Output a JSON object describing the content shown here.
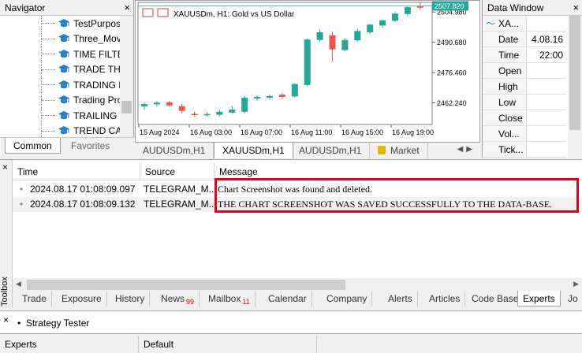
{
  "navigator": {
    "title": "Navigator",
    "items": [
      {
        "label": "TestPurpos"
      },
      {
        "label": "Three_Mov"
      },
      {
        "label": "TIME FILTE"
      },
      {
        "label": "TRADE THE"
      },
      {
        "label": "TRADING D"
      },
      {
        "label": "Trading Pro"
      },
      {
        "label": "TRAILING S"
      },
      {
        "label": "TREND CA"
      }
    ],
    "tabs": {
      "common": "Common",
      "favorites": "Favorites"
    }
  },
  "chart": {
    "title": "XAUUSDm, H1:  Gold vs US Dollar",
    "current_price": "2507.820",
    "colors": {
      "bull": "#26a69a",
      "bear": "#ef5350",
      "price_line": "#26a69a",
      "price_badge": "#26a69a"
    },
    "chart_data": {
      "type": "candlestick",
      "price_labels": [
        "2504.980",
        "2490.680",
        "2476.460",
        "2462.240"
      ],
      "price_values": [
        2504.98,
        2490.68,
        2476.46,
        2462.24
      ],
      "x_tick_labels": [
        "15 Aug 2024",
        "16 Aug 03:00",
        "16 Aug 07:00",
        "16 Aug 11:00",
        "16 Aug 15:00",
        "16 Aug 19:00"
      ],
      "ylim": [
        2452,
        2508
      ],
      "candles": [
        {
          "o": 2460.5,
          "h": 2462.2,
          "l": 2458.8,
          "c": 2461.6
        },
        {
          "o": 2461.5,
          "h": 2463.0,
          "l": 2460.4,
          "c": 2462.3
        },
        {
          "o": 2462.4,
          "h": 2463.2,
          "l": 2460.2,
          "c": 2461.0
        },
        {
          "o": 2460.6,
          "h": 2461.8,
          "l": 2457.2,
          "c": 2458.4
        },
        {
          "o": 2457.0,
          "h": 2458.0,
          "l": 2455.6,
          "c": 2456.8
        },
        {
          "o": 2456.4,
          "h": 2457.8,
          "l": 2455.6,
          "c": 2456.9
        },
        {
          "o": 2456.6,
          "h": 2458.8,
          "l": 2456.0,
          "c": 2458.0
        },
        {
          "o": 2457.6,
          "h": 2460.6,
          "l": 2457.0,
          "c": 2459.0
        },
        {
          "o": 2458.0,
          "h": 2465.4,
          "l": 2457.2,
          "c": 2464.6
        },
        {
          "o": 2464.2,
          "h": 2465.6,
          "l": 2463.2,
          "c": 2465.0
        },
        {
          "o": 2464.6,
          "h": 2466.2,
          "l": 2463.8,
          "c": 2465.4
        },
        {
          "o": 2466.0,
          "h": 2466.8,
          "l": 2464.2,
          "c": 2465.0
        },
        {
          "o": 2465.2,
          "h": 2471.4,
          "l": 2464.6,
          "c": 2471.0
        },
        {
          "o": 2470.6,
          "h": 2492.6,
          "l": 2470.0,
          "c": 2492.0
        },
        {
          "o": 2491.8,
          "h": 2496.8,
          "l": 2491.0,
          "c": 2495.4
        },
        {
          "o": 2494.0,
          "h": 2495.6,
          "l": 2481.8,
          "c": 2487.4
        },
        {
          "o": 2487.0,
          "h": 2492.6,
          "l": 2486.6,
          "c": 2491.8
        },
        {
          "o": 2491.6,
          "h": 2497.2,
          "l": 2491.0,
          "c": 2496.0
        },
        {
          "o": 2495.4,
          "h": 2499.4,
          "l": 2494.6,
          "c": 2499.0
        },
        {
          "o": 2498.6,
          "h": 2501.4,
          "l": 2497.6,
          "c": 2501.0
        },
        {
          "o": 2500.8,
          "h": 2505.0,
          "l": 2500.2,
          "c": 2504.2
        },
        {
          "o": 2504.0,
          "h": 2507.6,
          "l": 2502.8,
          "c": 2507.2
        },
        {
          "o": 2507.6,
          "h": 2509.8,
          "l": 2506.0,
          "c": 2507.0
        }
      ]
    },
    "tabs": [
      {
        "label": "AUDUSDm,H1"
      },
      {
        "label": "XAUUSDm,H1"
      },
      {
        "label": "AUDUSDm,H1"
      },
      {
        "label": "Market"
      }
    ]
  },
  "data_window": {
    "title": "Data Window",
    "rows": [
      {
        "k": "XA...",
        "v": ""
      },
      {
        "k": "Date",
        "v": "4.08.16"
      },
      {
        "k": "Time",
        "v": "22:00"
      },
      {
        "k": "Open",
        "v": ""
      },
      {
        "k": "High",
        "v": ""
      },
      {
        "k": "Low",
        "v": ""
      },
      {
        "k": "Close",
        "v": ""
      },
      {
        "k": "Vol...",
        "v": ""
      },
      {
        "k": "Tick...",
        "v": ""
      }
    ]
  },
  "toolbox": {
    "side_label": "Toolbox",
    "columns": {
      "time": "Time",
      "source": "Source",
      "message": "Message"
    },
    "rows": [
      {
        "time": "2024.08.17 01:08:09.097",
        "source": "TELEGRAM_M...",
        "message": "Chart Screenshot was found and deleted."
      },
      {
        "time": "2024.08.17 01:08:09.132",
        "source": "TELEGRAM_M...",
        "message": "THE CHART SCREENSHOT WAS SAVED SUCCESSFULLY TO THE DATA-BASE."
      }
    ],
    "highlight_color": "#e0001b",
    "tabs": [
      {
        "label": "Trade"
      },
      {
        "label": "Exposure"
      },
      {
        "label": "History"
      },
      {
        "label": "News",
        "count": "99"
      },
      {
        "label": "Mailbox",
        "count": "11"
      },
      {
        "label": "Calendar"
      },
      {
        "label": "Company"
      },
      {
        "label": "Alerts"
      },
      {
        "label": "Articles"
      },
      {
        "label": "Code Base"
      },
      {
        "label": "Experts"
      },
      {
        "label": "Jo"
      }
    ]
  },
  "tester": {
    "item": "Strategy Tester"
  },
  "status": {
    "left": "Experts",
    "middle": "Default"
  }
}
